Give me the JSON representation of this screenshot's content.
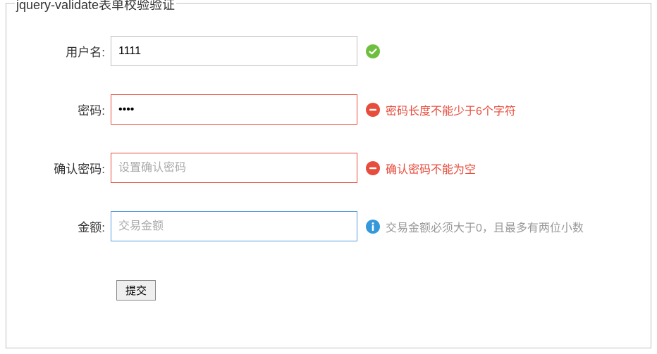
{
  "legend": "jquery-validate表单校验验证",
  "fields": {
    "username": {
      "label": "用户名:",
      "value": "1111",
      "placeholder": ""
    },
    "password": {
      "label": "密码:",
      "value": "••••",
      "error_msg": "密码长度不能少于6个字符"
    },
    "confirm": {
      "label": "确认密码:",
      "value": "",
      "placeholder": "设置确认密码",
      "error_msg": "确认密码不能为空"
    },
    "amount": {
      "label": "金额:",
      "value": "",
      "placeholder": "交易金额",
      "info_msg": "交易金额必须大于0，且最多有两位小数"
    }
  },
  "submit_label": "提交",
  "colors": {
    "error": "#e74c3c",
    "success": "#6fbf3f",
    "info": "#3498db",
    "focus_border": "#5b9dd9"
  }
}
